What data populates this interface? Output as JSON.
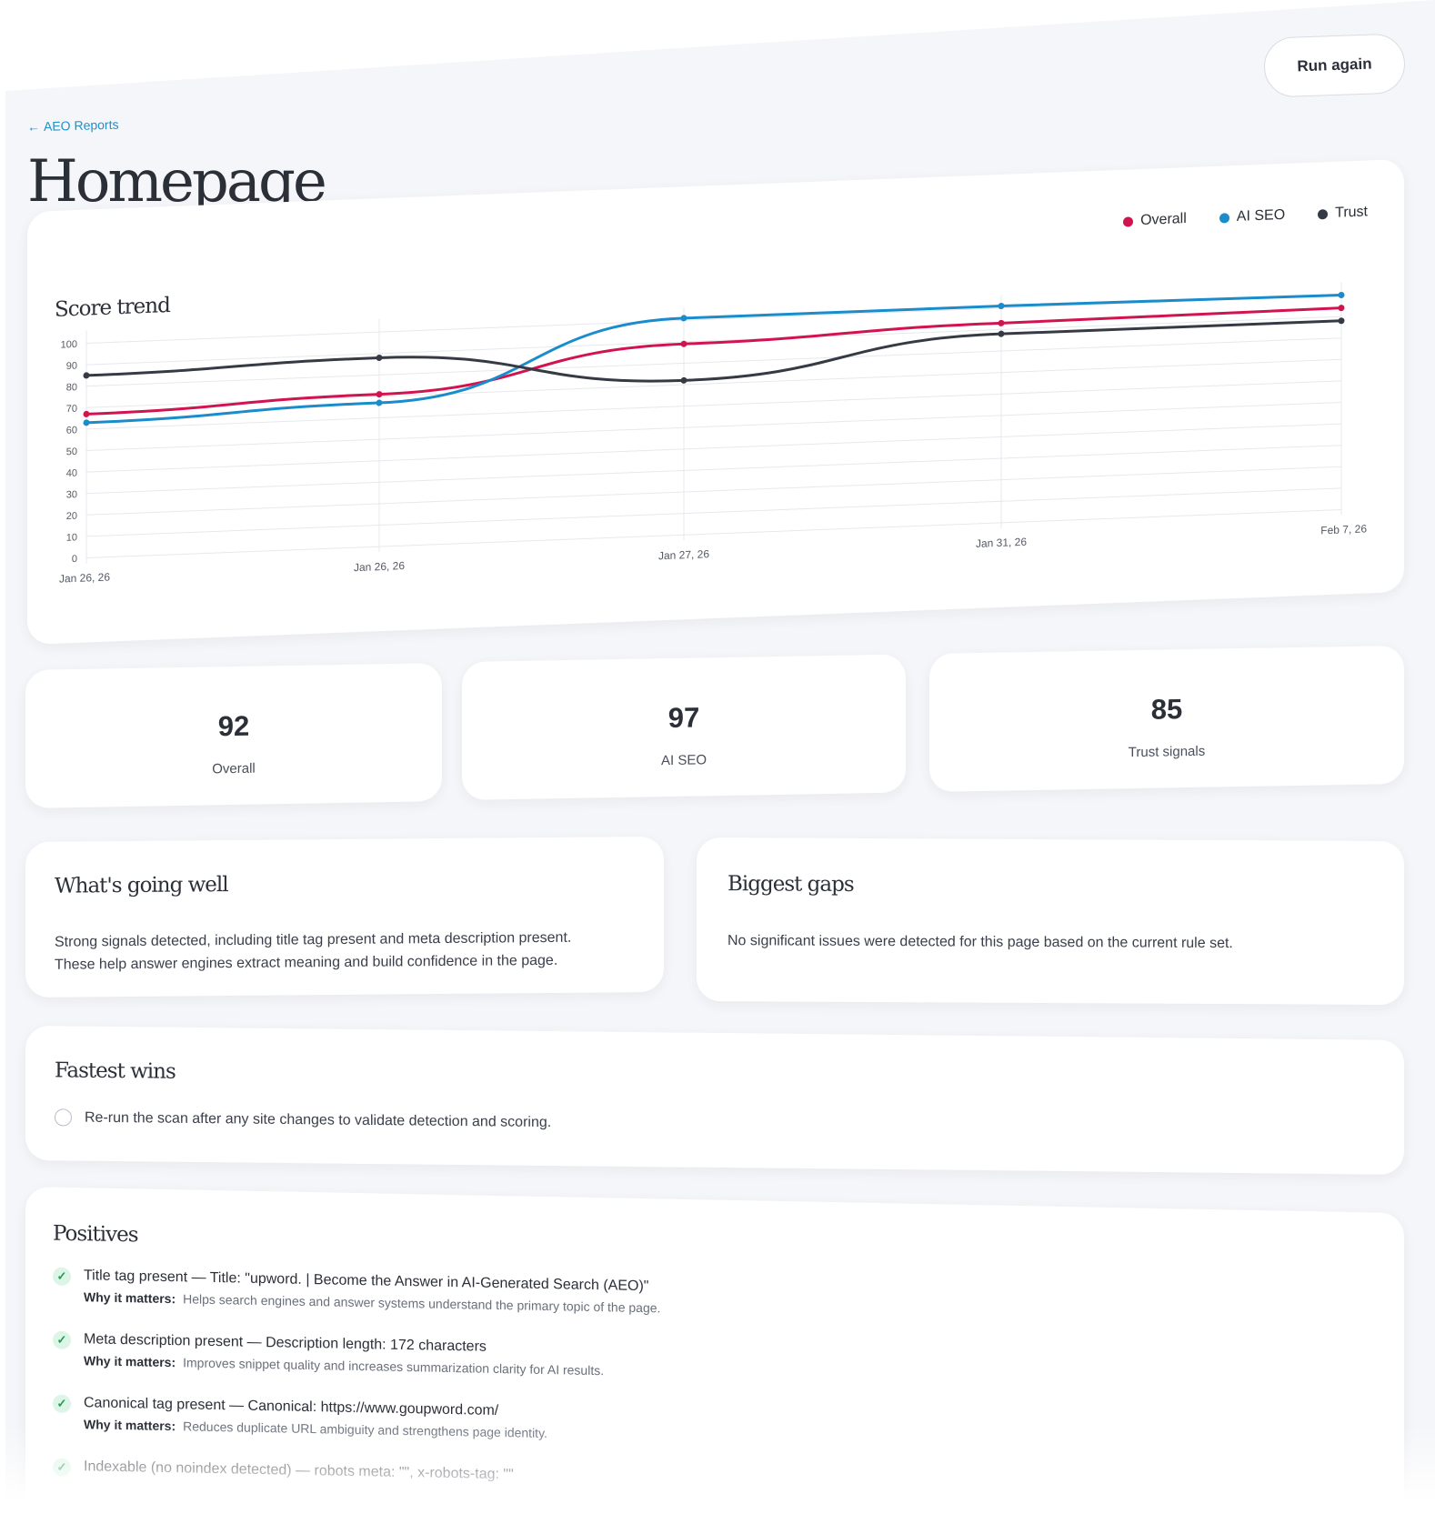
{
  "header": {
    "run_again_label": "Run again",
    "back_link_label": "AEO Reports",
    "page_title": "Homepage"
  },
  "chart_card": {
    "title": "Score trend",
    "legend": [
      {
        "name": "Overall",
        "color": "#d1134f"
      },
      {
        "name": "AI SEO",
        "color": "#1b8ccb"
      },
      {
        "name": "Trust",
        "color": "#363a45"
      }
    ]
  },
  "chart_data": {
    "type": "line",
    "title": "Score trend",
    "x": [
      "Jan 26, 26",
      "Jan 26, 26",
      "Jan 27, 26",
      "Jan 31, 26",
      "Feb 7, 26"
    ],
    "ylim": [
      0,
      100
    ],
    "yticks": [
      0,
      10,
      20,
      30,
      40,
      50,
      60,
      70,
      80,
      90,
      100
    ],
    "grid": true,
    "legend_position": "top-right",
    "series": [
      {
        "name": "Overall",
        "color": "#d1134f",
        "values": [
          67,
          71,
          89,
          93,
          94
        ]
      },
      {
        "name": "AI SEO",
        "color": "#1b8ccb",
        "values": [
          63,
          67,
          101,
          101,
          100
        ]
      },
      {
        "name": "Trust",
        "color": "#363a45",
        "values": [
          85,
          88,
          72,
          88,
          88
        ]
      }
    ]
  },
  "stats": [
    {
      "value": "92",
      "label": "Overall"
    },
    {
      "value": "97",
      "label": "AI SEO"
    },
    {
      "value": "85",
      "label": "Trust signals"
    }
  ],
  "going_well": {
    "title": "What's going well",
    "line1": "Strong signals detected, including title tag present and meta description present.",
    "line2": "These help answer engines extract meaning and build confidence in the page."
  },
  "gaps": {
    "title": "Biggest gaps",
    "text": "No significant issues were detected for this page based on the current rule set."
  },
  "fastest_wins": {
    "title": "Fastest wins",
    "items": [
      "Re-run the scan after any site changes to validate detection and scoring."
    ]
  },
  "positives": {
    "title": "Positives",
    "why_label": "Why it matters:",
    "items": [
      {
        "name": "Title tag present",
        "detail": "Title: \"upword. | Become the Answer in AI-Generated Search (AEO)\"",
        "why": "Helps search engines and answer systems understand the primary topic of the page."
      },
      {
        "name": "Meta description present",
        "detail": "Description length: 172 characters",
        "why": "Improves snippet quality and increases summarization clarity for AI results."
      },
      {
        "name": "Canonical tag present",
        "detail": "Canonical: https://www.goupword.com/",
        "why": "Reduces duplicate URL ambiguity and strengthens page identity."
      },
      {
        "name": "Indexable (no noindex detected)",
        "detail": "robots meta: \"\", x-robots-tag: \"\"",
        "why": ""
      }
    ]
  }
}
